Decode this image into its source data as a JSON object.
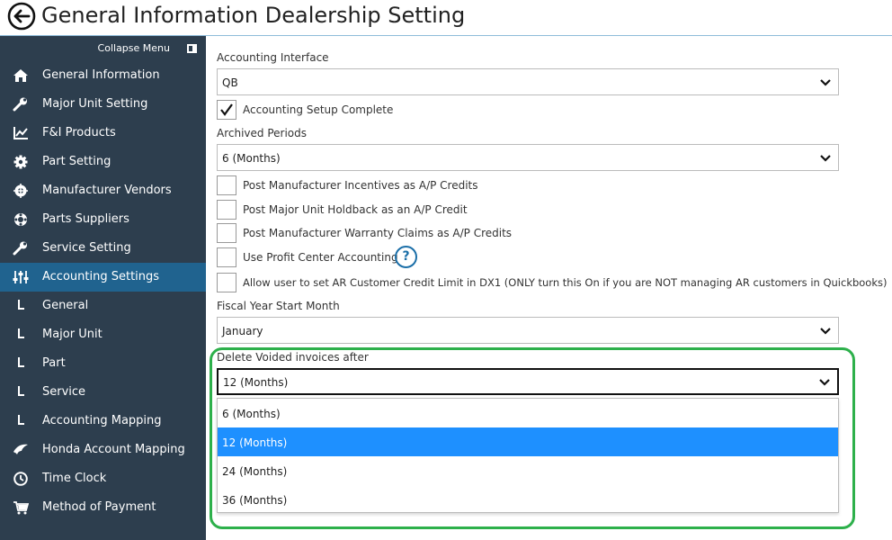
{
  "header": {
    "title": "General Information Dealership Setting"
  },
  "sidebar": {
    "collapse_label": "Collapse Menu",
    "items": [
      {
        "label": "General Information",
        "icon": "home-icon"
      },
      {
        "label": "Major Unit Setting",
        "icon": "wrench-icon"
      },
      {
        "label": "F&I Products",
        "icon": "chart-icon"
      },
      {
        "label": "Part Setting",
        "icon": "gear-icon"
      },
      {
        "label": "Manufacturer Vendors",
        "icon": "crosshair-icon"
      },
      {
        "label": "Parts Suppliers",
        "icon": "lifebuoy-icon"
      },
      {
        "label": "Service Setting",
        "icon": "wrench-icon"
      },
      {
        "label": "Accounting Settings",
        "icon": "sliders-icon",
        "active": true
      },
      {
        "label": "General",
        "icon": "sub-item-icon"
      },
      {
        "label": "Major Unit",
        "icon": "sub-item-icon"
      },
      {
        "label": "Part",
        "icon": "sub-item-icon"
      },
      {
        "label": "Service",
        "icon": "sub-item-icon"
      },
      {
        "label": "Accounting Mapping",
        "icon": "sub-item-icon"
      },
      {
        "label": "Honda Account Mapping",
        "icon": "honda-wing-icon"
      },
      {
        "label": "Time Clock",
        "icon": "clock-icon"
      },
      {
        "label": "Method of Payment",
        "icon": "cart-icon"
      }
    ]
  },
  "form": {
    "accounting_interface": {
      "label": "Accounting Interface",
      "value": "QB"
    },
    "accounting_setup_complete": {
      "label": "Accounting Setup Complete",
      "checked": true
    },
    "archived_periods": {
      "label": "Archived Periods",
      "value": "6 (Months)"
    },
    "checkboxes": [
      {
        "label": "Post Manufacturer Incentives as A/P Credits",
        "checked": false
      },
      {
        "label": "Post Major Unit Holdback as an A/P Credit",
        "checked": false
      },
      {
        "label": "Post Manufacturer Warranty Claims as A/P Credits",
        "checked": false
      },
      {
        "label": "Use Profit Center Accounting",
        "checked": false
      },
      {
        "label": "Allow user to set AR Customer Credit Limit in DX1 (ONLY turn this On if you are NOT managing AR customers in Quickbooks)",
        "checked": false
      }
    ],
    "help_glyph": "?",
    "fiscal_year_start_month": {
      "label": "Fiscal Year Start Month",
      "value": "January"
    },
    "delete_voided_invoices": {
      "label": "Delete Voided invoices after",
      "value": "12 (Months)",
      "options": [
        "6 (Months)",
        "12 (Months)",
        "24 (Months)",
        "36 (Months)"
      ],
      "selected_index": 1
    }
  },
  "colors": {
    "sidebar_bg": "#2d3e4e",
    "sidebar_active": "#20638f",
    "option_selected": "#1e90ff",
    "highlight_green": "#2db04b",
    "help_blue": "#1b6fa8"
  }
}
